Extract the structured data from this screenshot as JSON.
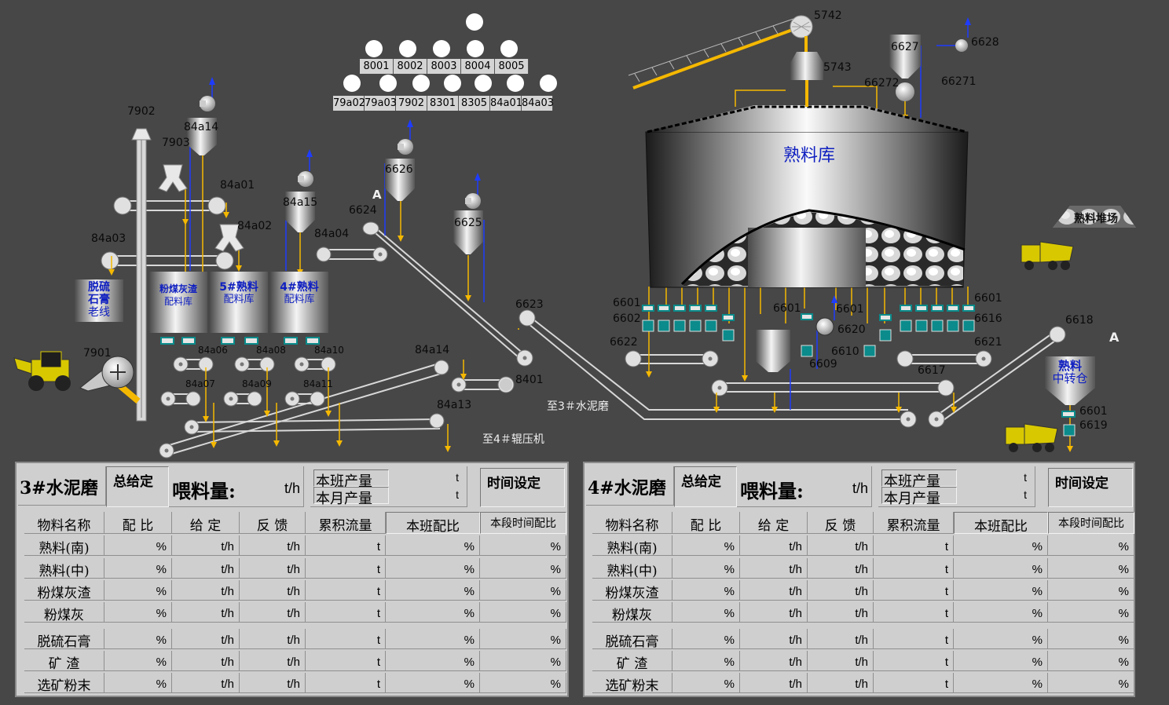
{
  "bins_top": [
    "8001",
    "8002",
    "8003",
    "8004",
    "8005"
  ],
  "bins_bottom": [
    "79a02",
    "79a03",
    "7902",
    "8301",
    "8305",
    "84a01",
    "84a03"
  ],
  "tags": {
    "t5742": "5742",
    "t5743": "5743",
    "t6627": "6627",
    "t6628": "6628",
    "t66272": "66272",
    "t66271": "66271",
    "t7902": "7902",
    "t7903": "7903",
    "t84a14": "84a14",
    "t84a01": "84a01",
    "t84a15": "84a15",
    "t84a02": "84a02",
    "t84a03": "84a03",
    "t84a04": "84a04",
    "t6626": "6626",
    "t6624": "6624",
    "tA1": "A",
    "t6625": "6625",
    "t6623": "6623",
    "t84a06": "84a06",
    "t84a08": "84a08",
    "t84a10": "84a10",
    "t84a07": "84a07",
    "t84a09": "84a09",
    "t84a11": "84a11",
    "t84a14b": "84a14",
    "t8401": "8401",
    "t84a13": "84a13",
    "t7901": "7901",
    "t6601a": "6601",
    "t6602": "6602",
    "t6622": "6622",
    "t6601b": "6601",
    "t6601c": "6601",
    "t6620": "6620",
    "t6610": "6610",
    "t6609": "6609",
    "t6601d": "6601",
    "t6616": "6616",
    "t6621": "6621",
    "t6617": "6617",
    "t6618": "6618",
    "tA2": "A",
    "t6601e": "6601",
    "t6619": "6619"
  },
  "silos": {
    "desulf": [
      "脱硫",
      "石膏",
      "老线"
    ],
    "flyash": [
      "粉煤灰渣",
      "配料库"
    ],
    "clinker5": [
      "5#熟料",
      "配料库"
    ],
    "clinker4": [
      "4#熟料",
      "配料库"
    ]
  },
  "clinker_store": "熟料库",
  "clinker_yard": "熟料堆场",
  "transfer_bin": [
    "熟料",
    "中转仓"
  ],
  "dest_mill3": "至3＃水泥磨",
  "dest_roller4": "至4＃辊压机",
  "panels": [
    {
      "mill": "3#水泥磨",
      "total_set": "总给定",
      "feed_label": "喂料量:",
      "feed_unit": "t/h",
      "shift_output": "本班产量",
      "month_output": "本月产量",
      "out_unit": "t",
      "time_set": "时间设定",
      "cols": [
        "物料名称",
        "配 比",
        "给 定",
        "反 馈",
        "累积流量",
        "本班配比",
        "本段时间配比"
      ],
      "units": [
        "%",
        "t/h",
        "t/h",
        "t",
        "%",
        "%"
      ],
      "rows": [
        "熟料(南)",
        "熟料(中)",
        "粉煤灰渣",
        "粉煤灰",
        "脱硫石膏",
        "矿 渣",
        "选矿粉末"
      ]
    },
    {
      "mill": "4#水泥磨",
      "total_set": "总给定",
      "feed_label": "喂料量:",
      "feed_unit": "t/h",
      "shift_output": "本班产量",
      "month_output": "本月产量",
      "out_unit": "t",
      "time_set": "时间设定",
      "cols": [
        "物料名称",
        "配 比",
        "给 定",
        "反 馈",
        "累积流量",
        "本班配比",
        "本段时间配比"
      ],
      "units": [
        "%",
        "t/h",
        "t/h",
        "t",
        "%",
        "%"
      ],
      "rows": [
        "熟料(南)",
        "熟料(中)",
        "粉煤灰渣",
        "粉煤灰",
        "脱硫石膏",
        "矿 渣",
        "选矿粉末"
      ]
    }
  ],
  "colors": {
    "background": "#474747",
    "material_line": "#f5b800",
    "air_line": "#1e3cff",
    "feeder": "#0b8b8b"
  }
}
